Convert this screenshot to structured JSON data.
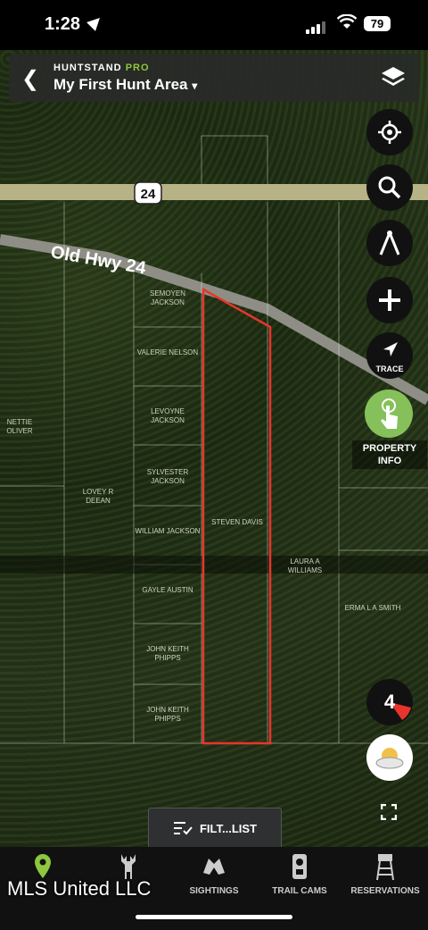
{
  "status": {
    "time": "1:28",
    "battery": "79"
  },
  "header": {
    "brand": "HUNTSTAND",
    "brand_tier": "PRO",
    "area_name": "My First Hunt Area",
    "area_caret": "▾"
  },
  "map": {
    "route_shield": "24",
    "road_label": "Old Hwy 24",
    "parcels": [
      "SEMOYEN JACKSON",
      "VALERIE NELSON",
      "LEVOYNE JACKSON",
      "SYLVESTER JACKSON",
      "WILLIAM JACKSON",
      "GAYLE AUSTIN",
      "JOHN KEITH PHIPPS",
      "JOHN KEITH PHIPPS",
      "STEVEN DAVIS",
      "LAURA A WILLIAMS",
      "ERMA L A SMITH",
      "LOVEY R DEEAN",
      "NETTIE OLIVER"
    ],
    "wind_count": "4"
  },
  "controls": {
    "trace_label": "TRACE",
    "property_info_label": "PROPERTY INFO"
  },
  "filter": {
    "label": "FILT...LIST"
  },
  "nav": {
    "items": [
      {
        "label": "",
        "icon": "location-pin-icon"
      },
      {
        "label": "",
        "icon": "deer-icon"
      },
      {
        "label": "SIGHTINGS",
        "icon": "binoculars-icon"
      },
      {
        "label": "TRAIL CAMS",
        "icon": "trail-cam-icon"
      },
      {
        "label": "RESERVATIONS",
        "icon": "tree-stand-icon"
      }
    ]
  },
  "watermark": "MLS United LLC",
  "colors": {
    "accent_green": "#8ec63f",
    "property_green": "#86c05a",
    "boundary_red": "#e8352b"
  }
}
